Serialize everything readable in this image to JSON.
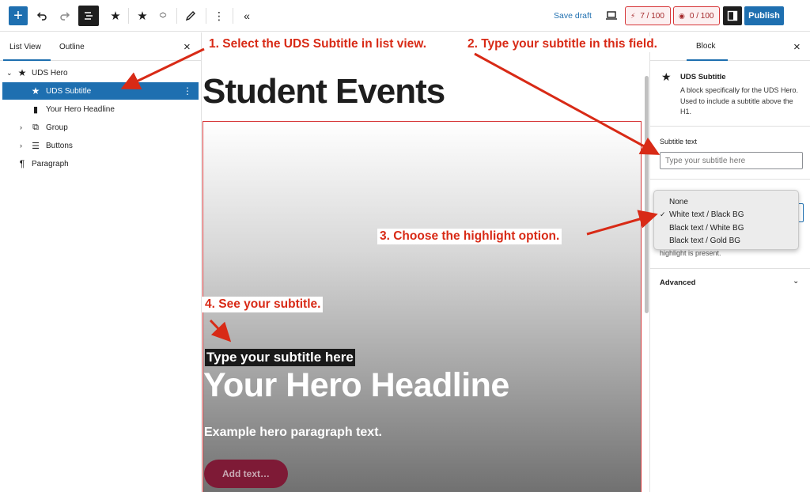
{
  "toolbar": {
    "add_icon": "plus-icon",
    "save_draft": "Save draft",
    "counter1": "7 / 100",
    "counter2": "0 / 100",
    "publish": "Publish"
  },
  "list_view": {
    "tabs": [
      "List View",
      "Outline"
    ],
    "items": [
      {
        "label": "UDS Hero",
        "icon": "star-icon"
      },
      {
        "label": "UDS Subtitle",
        "icon": "star-icon"
      },
      {
        "label": "Your Hero Headline",
        "icon": "bookmark-icon"
      },
      {
        "label": "Group",
        "icon": "group-icon"
      },
      {
        "label": "Buttons",
        "icon": "buttons-icon"
      },
      {
        "label": "Paragraph",
        "icon": "paragraph-icon"
      }
    ]
  },
  "canvas": {
    "page_title": "Student Events",
    "subtitle": "Type your subtitle here",
    "headline": "Your Hero Headline",
    "paragraph": "Example hero paragraph text.",
    "button": "Add text…"
  },
  "sidebar": {
    "tab": "Block",
    "block_title": "UDS Subtitle",
    "block_desc": "A block specifically for the UDS Hero. Used to include a subtitle above the H1.",
    "field_label": "Subtitle text",
    "field_placeholder": "Type your subtitle here",
    "help_text": "highlight is present.",
    "advanced": "Advanced",
    "dropdown_options": [
      "None",
      "White text / Black BG",
      "Black text / White BG",
      "Black text / Gold BG"
    ],
    "selected_option": "White text / Black BG"
  },
  "annotations": {
    "step1": "1. Select the UDS Subtitle in list view.",
    "step2": "2. Type your subtitle in this field.",
    "step3": "3. Choose the highlight option.",
    "step4": "4. See your subtitle."
  },
  "colors": {
    "accent": "#1e6fb0",
    "annotation": "#d82a16",
    "hero_button": "#7e1a36"
  }
}
